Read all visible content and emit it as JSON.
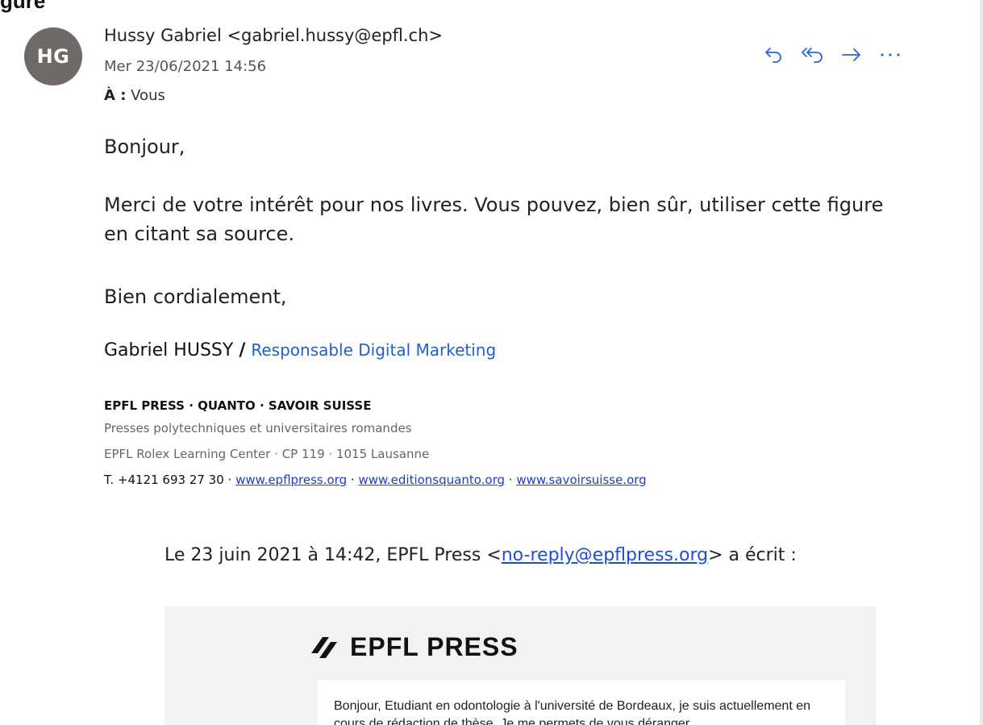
{
  "fragment_top": "gure",
  "message": {
    "avatar_initials": "HG",
    "sender": "Hussy Gabriel <gabriel.hussy@epfl.ch>",
    "date": "Mer 23/06/2021 14:56",
    "to_label": "À :",
    "to_value": "Vous"
  },
  "actions": {
    "reply": "reply-icon",
    "reply_all": "reply-all-icon",
    "forward": "forward-icon",
    "more": "more-icon",
    "accent_color": "#2b63d9"
  },
  "body": {
    "greeting": "Bonjour,",
    "paragraph": "Merci de votre intérêt pour nos livres. Vous pouvez, bien sûr, utiliser cette figure en citant sa source.",
    "closing": "Bien cordialement,"
  },
  "signature": {
    "name": "Gabriel HUSSY",
    "separator": "/",
    "role": "Responsable Digital Marketing",
    "brand": "EPFL PRESS · QUANTO · SAVOIR SUISSE",
    "subtitle": "Presses polytechniques et universitaires romandes",
    "address_1": "EPFL Rolex Learning Center",
    "address_2": "CP 119",
    "address_3": "1015 Lausanne",
    "dot": "·",
    "phone": "T. +4121 693 27 30",
    "link_1": "www.epflpress.org",
    "link_2": "www.editionsquanto.org",
    "link_3": "www.savoirsuisse.org"
  },
  "quoted": {
    "intro_before": "Le 23 juin 2021 à 14:42, EPFL Press <",
    "email": "no-reply@epflpress.org",
    "intro_after": "> a écrit :",
    "logo_text": "EPFL PRESS",
    "card_text": "Bonjour, Etudiant en odontologie à l'université de Bordeaux, je suis actuellement en cours de rédaction de thèse. Je me permets de vous déranger"
  }
}
